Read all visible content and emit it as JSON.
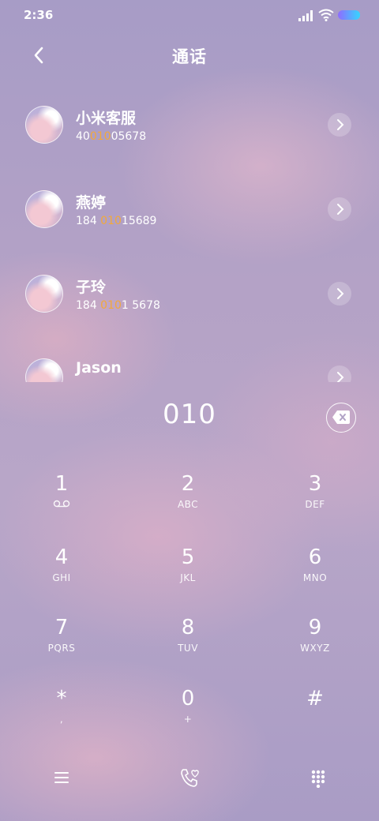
{
  "status": {
    "time": "2:36"
  },
  "header": {
    "title": "通话"
  },
  "contacts": [
    {
      "name": "小米客服",
      "number": [
        "40",
        "010",
        "05678"
      ]
    },
    {
      "name": "燕婷",
      "number": [
        "184 ",
        "010",
        "15689"
      ]
    },
    {
      "name": "子玲",
      "number": [
        "184 ",
        "010",
        "1 5678"
      ]
    },
    {
      "name": "Jason",
      "number": [
        "",
        "",
        ""
      ]
    }
  ],
  "dialer": {
    "input": "010",
    "keys": [
      {
        "num": "1",
        "sub": "voicemail-icon"
      },
      {
        "num": "2",
        "sub": "ABC"
      },
      {
        "num": "3",
        "sub": "DEF"
      },
      {
        "num": "4",
        "sub": "GHI"
      },
      {
        "num": "5",
        "sub": "JKL"
      },
      {
        "num": "6",
        "sub": "MNO"
      },
      {
        "num": "7",
        "sub": "PQRS"
      },
      {
        "num": "8",
        "sub": "TUV"
      },
      {
        "num": "9",
        "sub": "WXYZ"
      },
      {
        "num": "*",
        "sub": ","
      },
      {
        "num": "0",
        "sub": "+"
      },
      {
        "num": "#",
        "sub": ""
      }
    ]
  },
  "colors": {
    "highlight": "#f2a93b",
    "battery_start": "#8f6cff",
    "battery_end": "#35d6ff"
  }
}
